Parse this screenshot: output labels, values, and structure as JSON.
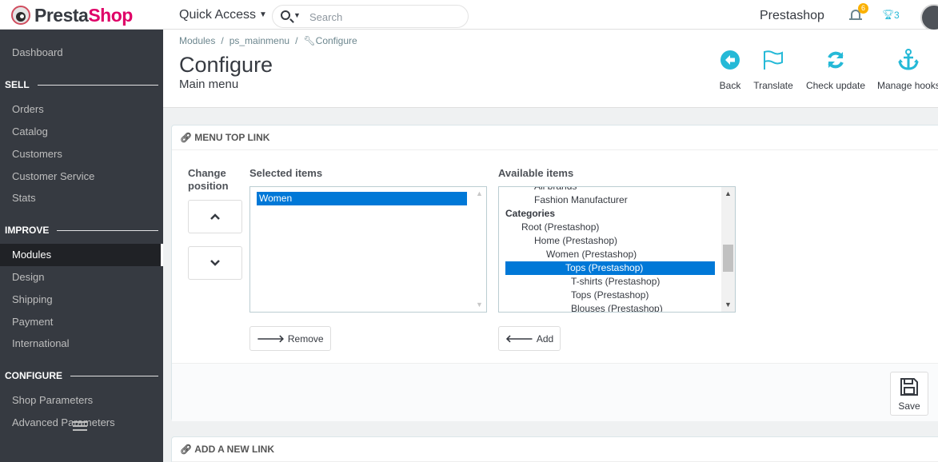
{
  "brand": {
    "name_part1": "Presta",
    "name_part2": "Shop"
  },
  "topbar": {
    "quick_access": "Quick Access",
    "search_placeholder": "Search",
    "shop_name": "Prestashop",
    "notifications_count": "6",
    "trophy_count": "3"
  },
  "sidebar": {
    "dashboard": "Dashboard",
    "sections": {
      "sell": "SELL",
      "improve": "IMPROVE",
      "configure": "CONFIGURE"
    },
    "sell_items": [
      "Orders",
      "Catalog",
      "Customers",
      "Customer Service",
      "Stats"
    ],
    "improve_items": [
      "Modules",
      "Design",
      "Shipping",
      "Payment",
      "International"
    ],
    "configure_items": [
      "Shop Parameters",
      "Advanced Parameters"
    ],
    "active_item": "Modules"
  },
  "breadcrumb": {
    "level1": "Modules",
    "level2": "ps_mainmenu",
    "level3": "Configure"
  },
  "header": {
    "title": "Configure",
    "subtitle": "Main menu",
    "buttons": {
      "back": "Back",
      "translate": "Translate",
      "check_update": "Check update",
      "manage_hooks": "Manage hooks"
    }
  },
  "menu_panel": {
    "heading": "MENU TOP LINK",
    "change_position_line1": "Change",
    "change_position_line2": "position",
    "selected_label": "Selected items",
    "available_label": "Available items",
    "selected_items": [
      "Women"
    ],
    "available_items": {
      "cut_top": "All brands",
      "manufacturer": "Fashion Manufacturer",
      "categories_group": "Categories",
      "cat_root": "Root (Prestashop)",
      "cat_home": "Home (Prestashop)",
      "cat_women": "Women (Prestashop)",
      "cat_tops": "Tops (Prestashop)",
      "cat_tshirts": "T-shirts (Prestashop)",
      "cat_tops2": "Tops (Prestashop)",
      "cat_blouses": "Blouses (Prestashop)"
    },
    "remove_label": "Remove",
    "add_label": "Add",
    "save_label": "Save"
  },
  "new_link_panel": {
    "heading": "ADD A NEW LINK"
  },
  "colors": {
    "sidebar_bg": "#363a41",
    "brand_pink": "#df0067",
    "accent_blue": "#25b9d7",
    "selection_blue": "#0078d7"
  }
}
